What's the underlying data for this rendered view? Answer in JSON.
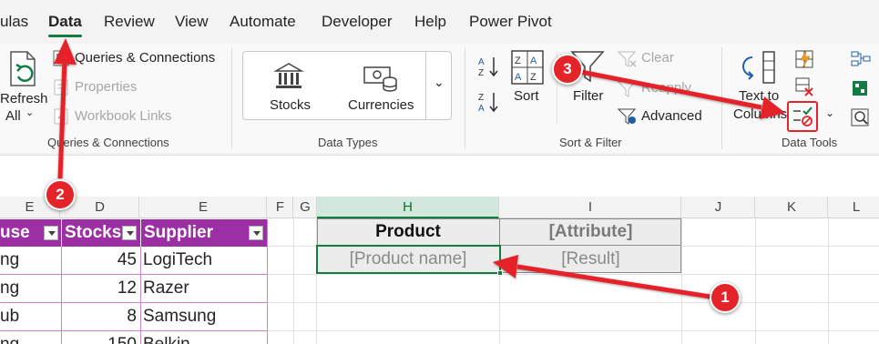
{
  "tabs": [
    "ulas",
    "Data",
    "Review",
    "View",
    "Automate",
    "Developer",
    "Help",
    "Power Pivot"
  ],
  "ribbon": {
    "get_data": {
      "refresh_line1": "Refresh",
      "refresh_line2": "All"
    },
    "queries": {
      "queries_connections": "Queries & Connections",
      "properties": "Properties",
      "workbook_links": "Workbook Links",
      "group_label": "Queries & Connections"
    },
    "data_types": {
      "stocks": "Stocks",
      "currencies": "Currencies",
      "group_label": "Data Types"
    },
    "sort_filter": {
      "sort": "Sort",
      "filter": "Filter",
      "clear": "Clear",
      "reapply": "Reapply",
      "advanced": "Advanced",
      "group_label": "Sort & Filter"
    },
    "data_tools": {
      "text_to_columns_1": "Text to",
      "text_to_columns_2": "Columns",
      "group_label": "Data Tools"
    }
  },
  "columns": [
    "E",
    "D",
    "E",
    "F",
    "G",
    "H",
    "I",
    "J",
    "K",
    "L"
  ],
  "product_table": {
    "headers": [
      "use",
      "Stocks",
      "Supplier"
    ],
    "rows": [
      {
        "house": "ng",
        "stocks": "45",
        "supplier": "LogiTech"
      },
      {
        "house": "ng",
        "stocks": "12",
        "supplier": "Razer"
      },
      {
        "house": "ub",
        "stocks": "8",
        "supplier": "Samsung"
      },
      {
        "house": "ng",
        "stocks": "150",
        "supplier": "Belkin"
      }
    ]
  },
  "lookup_table": {
    "header_product": "Product",
    "header_attribute": "[Attribute]",
    "product_value": "[Product name]",
    "result_value": "[Result]"
  },
  "annotations": [
    "1",
    "2",
    "3"
  ],
  "colors": {
    "accent_green": "#137c43",
    "table_purple": "#9b2fa3",
    "arrow_red": "#e5242a"
  }
}
